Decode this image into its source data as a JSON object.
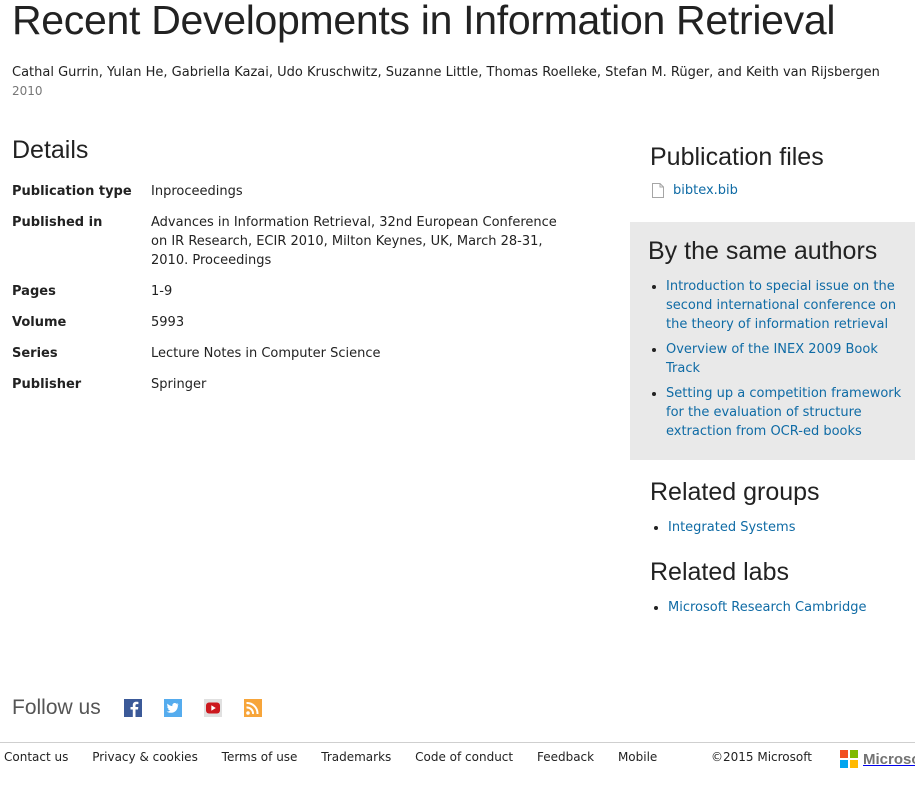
{
  "title": "Recent Developments in Information Retrieval",
  "authors": "Cathal Gurrin, Yulan He, Gabriella Kazai, Udo Kruschwitz, Suzanne Little, Thomas Roelleke, Stefan M. Rüger, and Keith van Rijsbergen",
  "year": "2010",
  "details": {
    "heading": "Details",
    "rows": [
      {
        "label": "Publication type",
        "value": "Inproceedings"
      },
      {
        "label": "Published in",
        "value": "Advances in Information Retrieval, 32nd European Conference on IR Research, ECIR 2010, Milton Keynes, UK, March 28-31, 2010. Proceedings"
      },
      {
        "label": "Pages",
        "value": "1-9"
      },
      {
        "label": "Volume",
        "value": "5993"
      },
      {
        "label": "Series",
        "value": "Lecture Notes in Computer Science"
      },
      {
        "label": "Publisher",
        "value": "Springer"
      }
    ]
  },
  "publication_files": {
    "heading": "Publication files",
    "file": "bibtex.bib",
    "icon": "document-icon"
  },
  "same_authors": {
    "heading": "By the same authors",
    "items": [
      "Introduction to special issue on the second international conference on the theory of information retrieval",
      "Overview of the INEX 2009 Book Track",
      "Setting up a competition framework for the evaluation of structure extraction from OCR-ed books"
    ]
  },
  "related_groups": {
    "heading": "Related groups",
    "items": [
      "Integrated Systems"
    ]
  },
  "related_labs": {
    "heading": "Related labs",
    "items": [
      "Microsoft Research Cambridge"
    ]
  },
  "follow": {
    "label": "Follow us",
    "icons": [
      "facebook-icon",
      "twitter-icon",
      "youtube-icon",
      "rss-icon"
    ]
  },
  "footer": {
    "links": [
      "Contact us",
      "Privacy & cookies",
      "Terms of use",
      "Trademarks",
      "Code of conduct",
      "Feedback",
      "Mobile"
    ],
    "copyright": "©2015 Microsoft",
    "logo_text": "Microsoft"
  },
  "colors": {
    "link": "#0f6ba5",
    "panel": "#e9e9e9",
    "ms_red": "#f25022",
    "ms_green": "#7fba00",
    "ms_blue": "#00a4ef",
    "ms_yellow": "#ffb900"
  }
}
